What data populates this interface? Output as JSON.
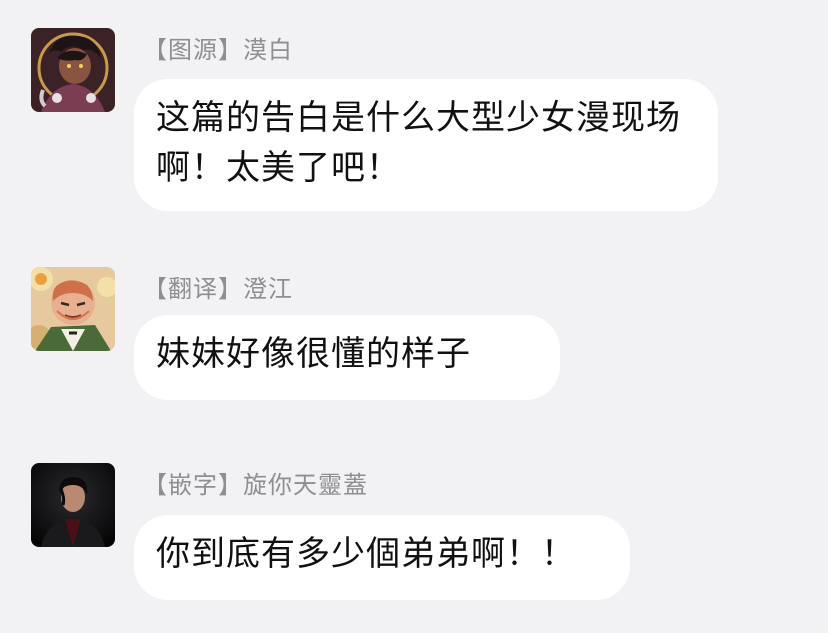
{
  "messages": [
    {
      "sender": "【图源】漠白",
      "avatar_icon": "dark-haired-character-avatar-icon",
      "text": "这篇的告白是什么大型少女漫现场啊！太美了吧！"
    },
    {
      "sender": "【翻译】澄江",
      "avatar_icon": "bald-anime-man-avatar-icon",
      "text": "妹妹好像很懂的样子"
    },
    {
      "sender": "【嵌字】旋你天靈蓋",
      "avatar_icon": "man-in-suit-avatar-icon",
      "text": "你到底有多少個弟弟啊！！"
    }
  ],
  "colors": {
    "background": "#f2f2f4",
    "bubble": "#ffffff",
    "sender_name": "#8e8e93",
    "message_text": "#111111"
  }
}
